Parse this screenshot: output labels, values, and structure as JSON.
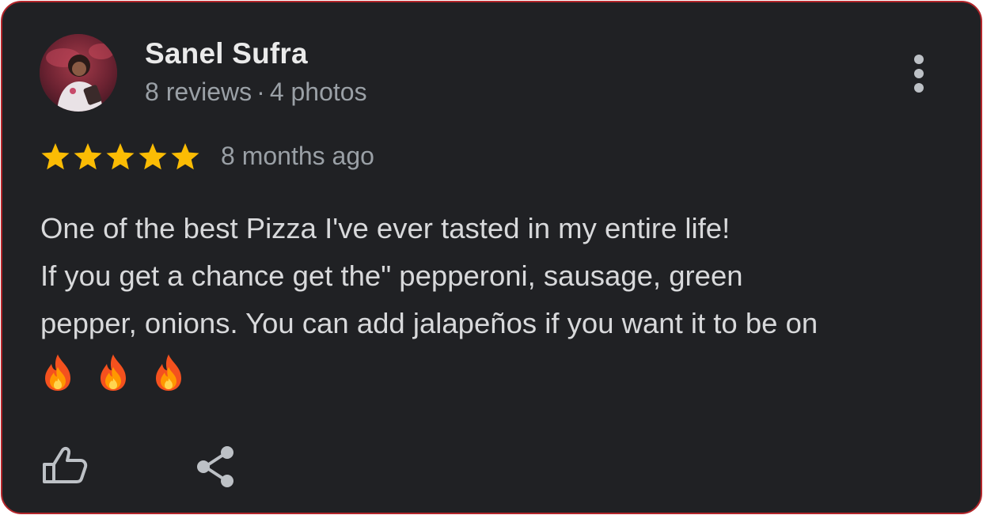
{
  "review": {
    "author_name": "Sanel Sufra",
    "reviews_count": "8 reviews",
    "separator": "·",
    "photos_count": "4 photos",
    "rating": 5,
    "rating_max": 5,
    "time_ago": "8 months ago",
    "text_lines": [
      "One of the best Pizza I've ever tasted in my entire life!",
      "If you get a chance get the\" pepperoni, sausage, green",
      "pepper, onions. You can add jalapeños if you want it to be on"
    ],
    "emojis": [
      "fire-emoji",
      "fire-emoji",
      "fire-emoji"
    ]
  },
  "icons": {
    "more": "more-vertical-icon",
    "like": "thumbs-up-icon",
    "share": "share-icon",
    "star": "star-icon"
  },
  "colors": {
    "card_background": "#202124",
    "card_border": "#b3262b",
    "star": "#fbbc04",
    "primary_text": "#eaeaea",
    "secondary_text": "#9aa0a6",
    "icon": "#bdc1c6"
  }
}
